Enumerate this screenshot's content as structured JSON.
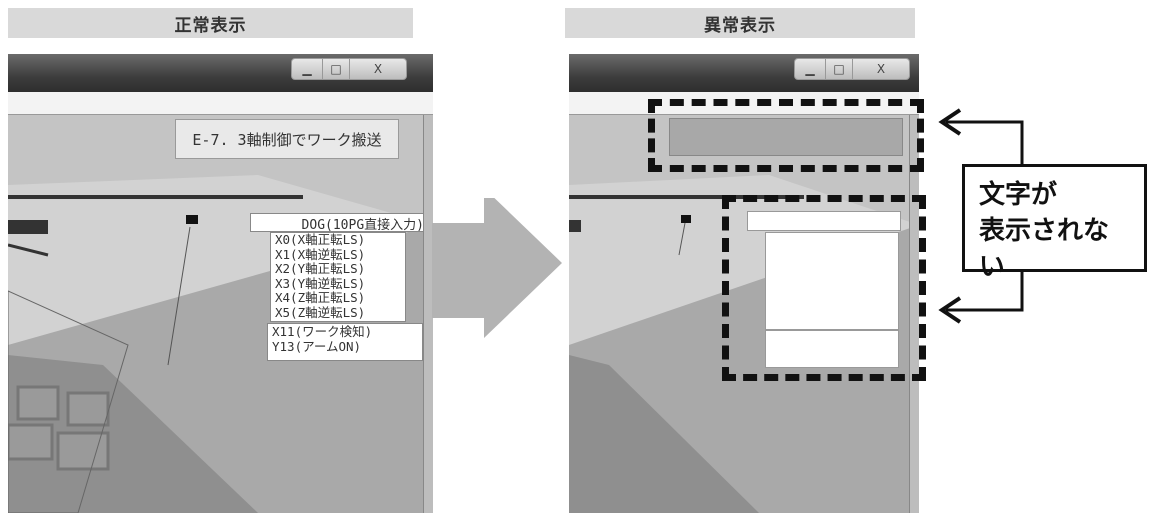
{
  "left": {
    "header": "正常表示",
    "window_buttons": {
      "minimize": "▁",
      "maximize": "□",
      "close": "X"
    },
    "title_box": "E-7. 3軸制御でワーク搬送",
    "dog_title": "DOG(10PG直接入力)",
    "dog_items": [
      "X0(X軸正転LS)",
      "X1(X軸逆転LS)",
      "X2(Y軸正転LS)",
      "X3(Y軸逆転LS)",
      "X4(Z軸正転LS)",
      "X5(Z軸逆転LS)"
    ],
    "sensor_items": [
      "X11(ワーク検知)",
      "Y13(アームON)"
    ]
  },
  "arrow": "transition-arrow",
  "right": {
    "header": "異常表示",
    "window_buttons": {
      "minimize": "▁",
      "maximize": "□",
      "close": "X"
    }
  },
  "callout": {
    "line1": "文字が",
    "line2": "表示されない"
  },
  "colors": {
    "header_bg": "#d9d9d9",
    "dash": "#111111",
    "arrow": "#b3b3b3"
  }
}
